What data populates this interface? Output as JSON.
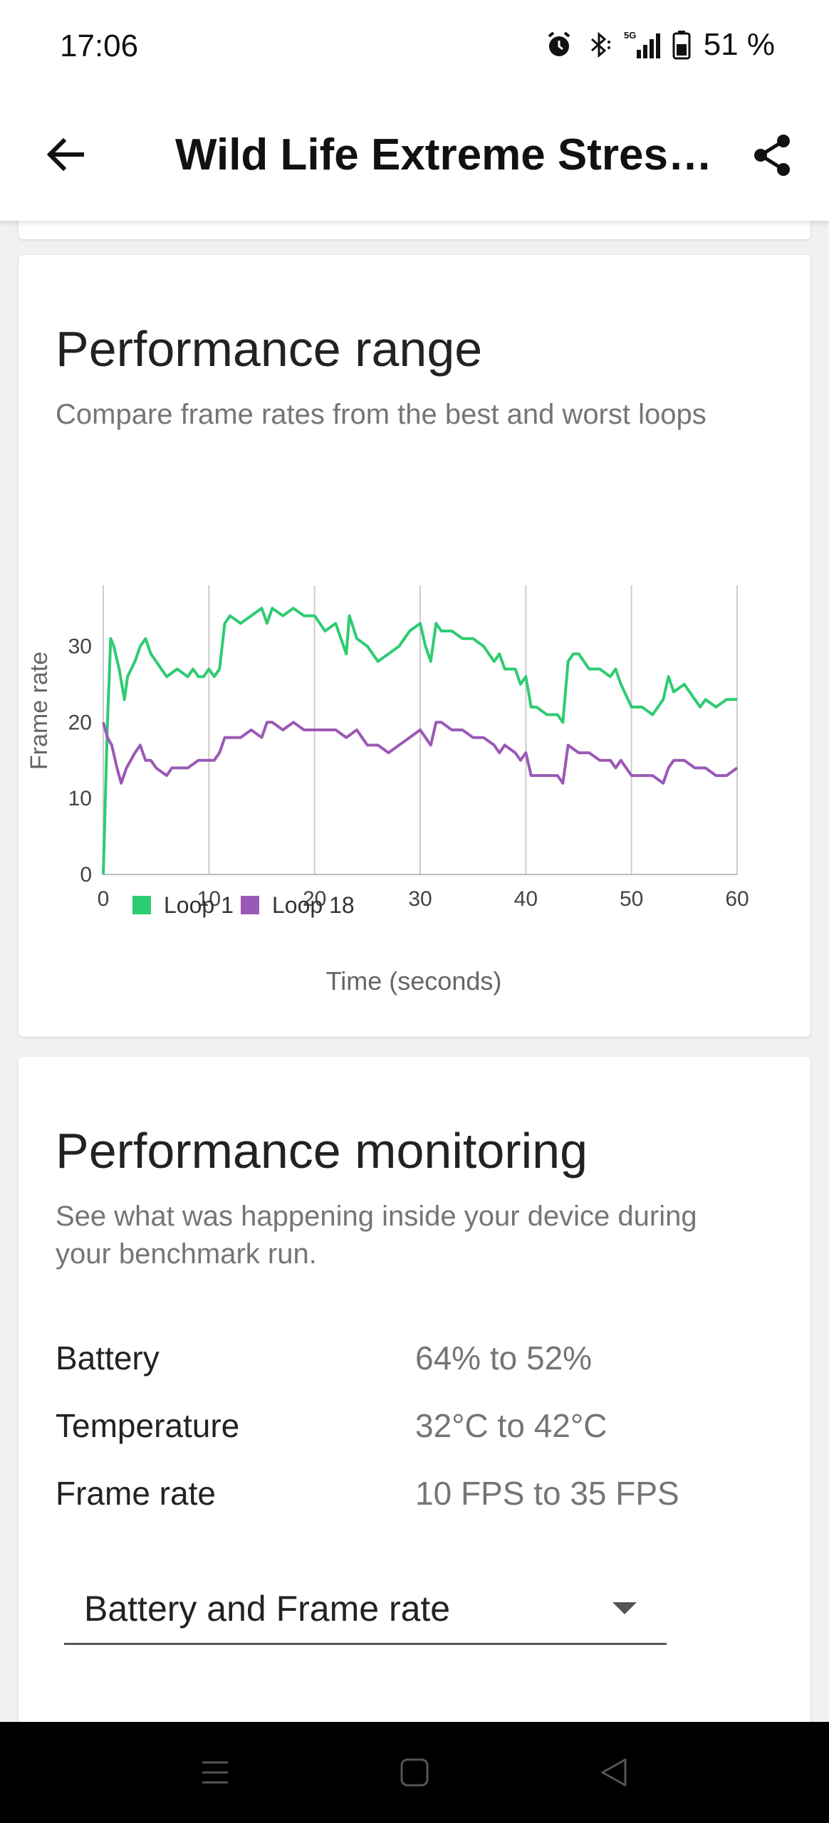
{
  "status_bar": {
    "time": "17:06",
    "network_label": "5G",
    "battery_text": "51 %",
    "icons": [
      "alarm-icon",
      "bluetooth-icon",
      "signal-icon",
      "battery-icon"
    ]
  },
  "app_bar": {
    "title": "Wild Life Extreme Stress…",
    "back_icon": "arrow-left-icon",
    "share_icon": "share-icon"
  },
  "performance_range": {
    "title": "Performance range",
    "subtitle": "Compare frame rates from the best and worst loops"
  },
  "chart_data": {
    "type": "line",
    "xlabel": "Time (seconds)",
    "ylabel": "Frame rate",
    "xlim": [
      0,
      60
    ],
    "ylim": [
      0,
      38
    ],
    "x_ticks": [
      "0",
      "10",
      "20",
      "30",
      "40",
      "50",
      "60"
    ],
    "y_ticks": [
      "0",
      "10",
      "20",
      "30"
    ],
    "grid": "vertical",
    "legend_position": "bottom-left",
    "series": [
      {
        "name": "Loop 1",
        "color": "#2ecc71",
        "x": [
          0,
          0.4,
          0.7,
          1,
          1.5,
          2,
          2.3,
          3,
          3.5,
          4,
          4.5,
          5,
          5.5,
          6,
          7,
          8,
          8.5,
          9,
          9.5,
          10,
          10.5,
          11,
          11.5,
          12,
          13,
          14,
          15,
          15.5,
          16,
          17,
          18,
          19,
          20,
          21,
          22,
          23,
          23.3,
          24,
          25,
          26,
          27,
          28,
          29,
          30,
          30.5,
          31,
          31.5,
          32,
          33,
          34,
          35,
          36,
          37,
          37.5,
          38,
          39,
          39.5,
          40,
          40.5,
          41,
          42,
          43,
          43.5,
          44,
          44.5,
          45,
          46,
          47,
          48,
          48.5,
          49,
          50,
          51,
          52,
          53,
          53.5,
          54,
          55,
          56,
          56.5,
          57,
          58,
          59,
          60
        ],
        "values": [
          0,
          20,
          31,
          30,
          27,
          23,
          26,
          28,
          30,
          31,
          29,
          28,
          27,
          26,
          27,
          26,
          27,
          26,
          26,
          27,
          26,
          27,
          33,
          34,
          33,
          34,
          35,
          33,
          35,
          34,
          35,
          34,
          34,
          32,
          33,
          29,
          34,
          31,
          30,
          28,
          29,
          30,
          32,
          33,
          30,
          28,
          33,
          32,
          32,
          31,
          31,
          30,
          28,
          29,
          27,
          27,
          25,
          26,
          22,
          22,
          21,
          21,
          20,
          28,
          29,
          29,
          27,
          27,
          26,
          27,
          25,
          22,
          22,
          21,
          23,
          26,
          24,
          25,
          23,
          22,
          23,
          22,
          23,
          23
        ]
      },
      {
        "name": "Loop 18",
        "color": "#9b59b6",
        "x": [
          0,
          0.4,
          0.8,
          1.3,
          1.7,
          2.2,
          3,
          3.5,
          4,
          4.5,
          5,
          6,
          6.5,
          7,
          7.5,
          8,
          9,
          10,
          10.5,
          11,
          11.5,
          12,
          13,
          14,
          15,
          15.5,
          16,
          17,
          18,
          19,
          20,
          21,
          22,
          23,
          24,
          25,
          26,
          27,
          28,
          29,
          30,
          30.5,
          31,
          31.5,
          32,
          33,
          34,
          35,
          36,
          37,
          37.5,
          38,
          39,
          39.5,
          40,
          40.5,
          41,
          42,
          43,
          43.5,
          44,
          45,
          46,
          47,
          48,
          48.5,
          49,
          50,
          51,
          52,
          53,
          53.5,
          54,
          55,
          56,
          57,
          58,
          59,
          60
        ],
        "values": [
          20,
          18,
          17,
          14,
          12,
          14,
          16,
          17,
          15,
          15,
          14,
          13,
          14,
          14,
          14,
          14,
          15,
          15,
          15,
          16,
          18,
          18,
          18,
          19,
          18,
          20,
          20,
          19,
          20,
          19,
          19,
          19,
          19,
          18,
          19,
          17,
          17,
          16,
          17,
          18,
          19,
          18,
          17,
          20,
          20,
          19,
          19,
          18,
          18,
          17,
          16,
          17,
          16,
          15,
          16,
          13,
          13,
          13,
          13,
          12,
          17,
          16,
          16,
          15,
          15,
          14,
          15,
          13,
          13,
          13,
          12,
          14,
          15,
          15,
          14,
          14,
          13,
          13,
          14
        ]
      }
    ]
  },
  "performance_monitoring": {
    "title": "Performance monitoring",
    "subtitle": "See what was happening inside your device during your benchmark run.",
    "stats": [
      {
        "label": "Battery",
        "value": "64% to 52%"
      },
      {
        "label": "Temperature",
        "value": "32°C to 42°C"
      },
      {
        "label": "Frame rate",
        "value": "10 FPS to 35 FPS"
      }
    ],
    "dropdown": {
      "selected": "Battery and Frame rate"
    }
  },
  "nav_bar": {
    "buttons": [
      "menu-icon",
      "home-icon",
      "back-triangle-icon"
    ]
  }
}
